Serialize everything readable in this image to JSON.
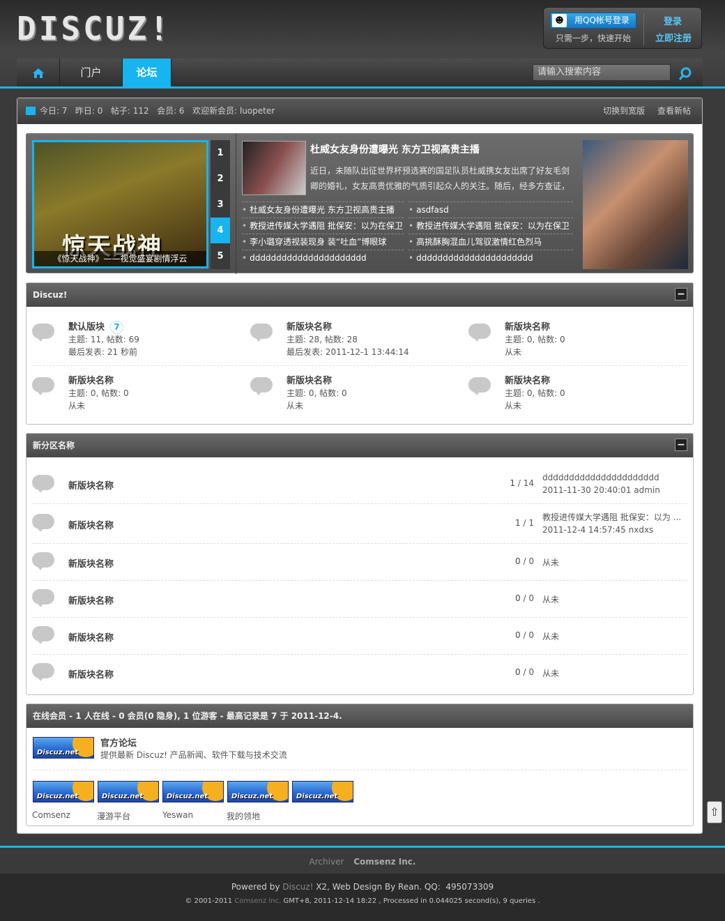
{
  "header": {
    "logo_text": "DISCUZ!",
    "qq_login_label": "用QQ帐号登录",
    "qq_icon": "qq-penguin-icon",
    "qq_sub": "只需一步，快速开始",
    "login_label": "登录",
    "register_label": "立即注册"
  },
  "nav": {
    "home_icon": "home-icon",
    "tabs": [
      {
        "label": "门户",
        "active": false
      },
      {
        "label": "论坛",
        "active": true
      }
    ],
    "search_placeholder": "请输入搜索内容",
    "search_icon": "search-icon"
  },
  "colors": {
    "accent": "#18b4f0",
    "header_bg": "#3a3a3a"
  },
  "stats": {
    "icon": "bar-chart-icon",
    "text": "今日: 7   昨日: 0   帖子: 112   会员: 6   欢迎新会员: luopeter",
    "link_wide": "切换到宽版",
    "link_new": "查看新帖"
  },
  "slider": {
    "big_title": "惊天战神",
    "caption": "《惊天战神》——视觉盛宴剧情浮云",
    "numbers": [
      "1",
      "2",
      "3",
      "4",
      "5"
    ],
    "active_number": "4",
    "headline": "杜威女友身份遭曝光 东方卫视高贵主播",
    "summary": "近日，未随队出征世界杯预选赛的国足队员杜威携女友出席了好友毛剑卿的婚礼，女友高贵优雅的气质引起众人的关注。随后，经多方查证，",
    "links_left": [
      "杜威女友身份遭曝光 东方卫视高贵主播",
      "教授进传媒大学遇阻 批保安：以为在保卫",
      "李小璐穿透视装现身 装“吐血”博眼球",
      "dddddddddddddddddddddd"
    ],
    "links_right": [
      "asdfasd",
      "教授进传媒大学遇阻 批保安：以为在保卫",
      "高挑酥胸混血儿驾驭激情红色烈马",
      "dddddddddddddddddddddd"
    ]
  },
  "section1": {
    "title": "Discuz!",
    "collapse_icon": "minus-icon",
    "forums": [
      {
        "name": "默认版块",
        "badge": "7",
        "stats": "主题: 11, 帖数: 69",
        "last": "最后发表: 21 秒前"
      },
      {
        "name": "新版块名称",
        "stats": "主题: 28, 帖数: 28",
        "last": "最后发表: 2011-12-1 13:44:14"
      },
      {
        "name": "新版块名称",
        "stats": "主题: 0, 帖数: 0",
        "last": "从未"
      },
      {
        "name": "新版块名称",
        "stats": "主题: 0, 帖数: 0",
        "last": "从未"
      },
      {
        "name": "新版块名称",
        "stats": "主题: 0, 帖数: 0",
        "last": "从未"
      },
      {
        "name": "新版块名称",
        "stats": "主题: 0, 帖数: 0",
        "last": "从未"
      }
    ]
  },
  "section2": {
    "title": "新分区名称",
    "collapse_icon": "minus-icon",
    "rows": [
      {
        "name": "新版块名称",
        "topics": "1",
        "posts": "14",
        "last1": "dddddddddddddddddddddd",
        "last2": "2011-11-30 20:40:01 admin"
      },
      {
        "name": "新版块名称",
        "topics": "1",
        "posts": "1",
        "last1": "教授进传媒大学遇阻 批保安：以为 ...",
        "last2": "2011-12-4 14:57:45 nxdxs"
      },
      {
        "name": "新版块名称",
        "topics": "0",
        "posts": "0",
        "last1": "从未",
        "last2": ""
      },
      {
        "name": "新版块名称",
        "topics": "0",
        "posts": "0",
        "last1": "从未",
        "last2": ""
      },
      {
        "name": "新版块名称",
        "topics": "0",
        "posts": "0",
        "last1": "从未",
        "last2": ""
      },
      {
        "name": "新版块名称",
        "topics": "0",
        "posts": "0",
        "last1": "从未",
        "last2": ""
      }
    ]
  },
  "section3": {
    "title": "在线会员 - 1 人在线 - 0 会员(0 隐身), 1 位游客 - 最高记录是 7 于 2011-12-4.",
    "official_name": "官方论坛",
    "official_desc": "提供最新 Discuz! 产品新闻、软件下载与技术交流",
    "logo_text": "Discuz.net",
    "links": [
      "Comsenz",
      "漫游平台",
      "Yeswan",
      "我的领地",
      ""
    ]
  },
  "footer": {
    "archiver": "Archiver",
    "company": "Comsenz Inc.",
    "powered_prefix": "Powered by ",
    "powered_brand": "Discuz!",
    "powered_suffix": " X2, Web Design By Rean. QQ:  495073309",
    "copy_prefix": "© 2001-2011 ",
    "copy_company": "Comsenz Inc.",
    "copy_suffix": " GMT+8, 2011-12-14 18:22 , Processed in 0.044025 second(s), 9 queries .",
    "scroll_top_icon": "arrow-up-icon"
  }
}
